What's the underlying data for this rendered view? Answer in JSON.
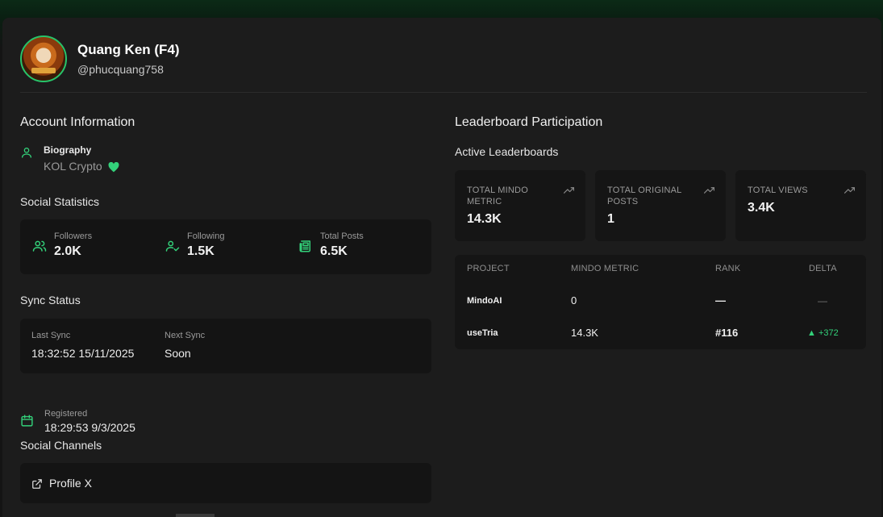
{
  "profile": {
    "name": "Quang Ken (F4)",
    "handle": "@phucquang758"
  },
  "account": {
    "title": "Account Information",
    "bio_label": "Biography",
    "bio_value": "KOL Crypto",
    "social_title": "Social Statistics",
    "stats": [
      {
        "label": "Followers",
        "value": "2.0K",
        "icon": "users-icon"
      },
      {
        "label": "Following",
        "value": "1.5K",
        "icon": "user-check-icon"
      },
      {
        "label": "Total Posts",
        "value": "6.5K",
        "icon": "newspaper-icon"
      }
    ],
    "sync_title": "Sync Status",
    "last_sync_label": "Last Sync",
    "last_sync_value": "18:32:52 15/11/2025",
    "next_sync_label": "Next Sync",
    "next_sync_value": "Soon",
    "registered_label": "Registered",
    "registered_value": "18:29:53 9/3/2025",
    "channels_title": "Social Channels",
    "profile_x_label": "Profile X"
  },
  "leaderboard": {
    "title": "Leaderboard Participation",
    "active_title": "Active Leaderboards",
    "metrics": [
      {
        "label_line1": "TOTAL MINDO",
        "label_line2": "METRIC",
        "value": "14.3K"
      },
      {
        "label_line1": "TOTAL ORIGINAL",
        "label_line2": "POSTS",
        "value": "1"
      },
      {
        "label_line1": "TOTAL VIEWS",
        "label_line2": "",
        "value": "3.4K"
      }
    ],
    "columns": [
      "PROJECT",
      "MINDO METRIC",
      "RANK",
      "DELTA"
    ],
    "rows": [
      {
        "project": "MindoAI",
        "metric": "0",
        "rank": "—",
        "delta": "—"
      },
      {
        "project": "useTria",
        "metric": "14.3K",
        "rank": "#116",
        "delta": "▲ +372"
      }
    ]
  },
  "colors": {
    "accent": "#33d17a",
    "background": "#1c1c1c",
    "panel": "#141414"
  }
}
